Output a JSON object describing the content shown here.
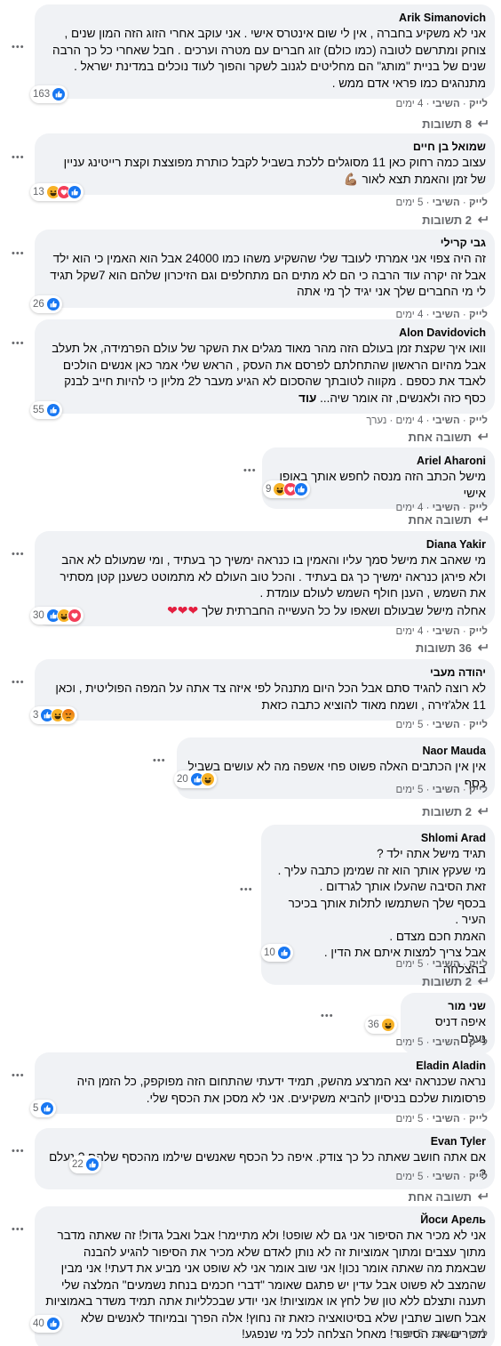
{
  "colors": {
    "bubble": "#f0f2f5",
    "meta": "#65676b",
    "like": "#1877f2",
    "love": "#f33e58",
    "haha": "#f7b125"
  },
  "icons": {
    "like": "like-reaction-icon",
    "love": "love-reaction-icon",
    "haha": "haha-reaction-icon",
    "angry": "angry-reaction-icon",
    "more": "more-options-icon",
    "reply": "reply-arrow-icon"
  },
  "comments": [
    {
      "author": "Arik Simanovich",
      "text": "אני לא משקיע בחברה , אין לי שום אינטרס אישי . אני עוקב אחרי הזוג הזה המון שנים , צוחק ומתרשם לטובה (כמו כולם) זוג חברים עם מטרה וערכים . חבל שאחרי כל כך הרבה שנים של בניית \"מותג\" הם מחליטים לגנוב לשקר והפוך לעוד נוכלים במדינת ישראל . מתנהגים כמו פראי אדם ממש .",
      "reactions": {
        "count": "163",
        "types": [
          "like"
        ]
      },
      "actions": {
        "like": "לייק",
        "reply": "השיבי",
        "time": "4 ימים"
      },
      "replies": "8 תשובות"
    },
    {
      "author": "שמואל בן חיים",
      "text": "עצוב כמה רחוק כאן 11 מסוגלים ללכת בשביל לקבל כותרת מפוצצת וקצת רייטינג עניין של זמן והאמת תצא לאור 💪🏽",
      "reactions": {
        "count": "13",
        "types": [
          "haha",
          "love",
          "like"
        ]
      },
      "actions": {
        "like": "לייק",
        "reply": "השיבי",
        "time": "5 ימים"
      },
      "replies": "2 תשובות"
    },
    {
      "author": "גבי קרילי",
      "text": "זה היה צפוי אני אמרתי לעובד שלי שהשקיע משהו כמו 24000 אבל הוא האמין כי הוא ילד אבל זה יקרה עוד הרבה כי הם לא מתים הם מתחלפים וגם הזיכרון שלהם הוא 7שקל תגיד לי מי החברים שלך אני יגיד לך מי אתה",
      "reactions": {
        "count": "26",
        "types": [
          "like"
        ]
      },
      "actions": {
        "like": "לייק",
        "reply": "השיבי",
        "time": "4 ימים"
      }
    },
    {
      "author": "Alon Davidovich",
      "text": "וואו איך שקצת זמן בעולם הזה מהר מאוד מגלים את השקר של עולם הפרמידה, אל תעלב אבל מהיום הראשון שהתחלתם לפרסם את העסק , הראש שלי אמר כאן אנשים הולכים לאבד את כספם . מקווה לטובתך שהסכום לא הגיע מעבר ל2 מליון כי להיות חייב לבנק כסף כזה ולאנשים, זה אומר שיה...",
      "more": "עוד",
      "reactions": {
        "count": "55",
        "types": [
          "like"
        ]
      },
      "actions": {
        "like": "לייק",
        "reply": "השיבי",
        "time": "4 ימים",
        "edited": "נערך"
      },
      "replies": "תשובה אחת"
    },
    {
      "author": "Ariel Aharoni",
      "text": "מישל הכתב הזה מנסה לחפש אותך באופן אישי",
      "reactions": {
        "count": "9",
        "types": [
          "haha",
          "love",
          "like"
        ]
      },
      "actions": {
        "like": "לייק",
        "reply": "השיבי",
        "time": "4 ימים"
      },
      "replies": "תשובה אחת"
    },
    {
      "author": "Diana Yakir",
      "text": "מי שאהב את מישל סמך עליו והאמין בו כנראה ימשיך כך בעתיד , ומי שמעולם לא אהב ולא פירגן כנראה ימשיך כך גם בעתיד . והכל טוב העולם לא מתמוטט כשענן קטן מסתיר את השמש , הענן חולף השמש לעולם עומדת .\nאחלה מישל שבעולם ושאפו על כל העשייה החברתית שלך",
      "hearts": "❤❤❤",
      "reactions": {
        "count": "30",
        "types": [
          "like",
          "haha",
          "love"
        ]
      },
      "actions": {
        "like": "לייק",
        "reply": "השיבי",
        "time": "4 ימים"
      },
      "replies": "36 תשובות"
    },
    {
      "author": "יהודה מעבי",
      "text": "לא רוצה להגיד סתם אבל הכל היום מתנהל לפי איזה צד אתה על המפה הפוליטית , וכאן 11 אלג'זירה , ושמח מאוד להוציא כתבה כזאת",
      "reactions": {
        "count": "3",
        "types": [
          "like",
          "haha",
          "angry"
        ]
      },
      "actions": {
        "like": "לייק",
        "reply": "השיבי",
        "time": "5 ימים"
      }
    },
    {
      "author": "Naor Mauda",
      "text": "אין אין הכתבים האלה פשוט פחי אשפה מה לא עושים בשביל כסף",
      "reactions": {
        "count": "20",
        "types": [
          "like",
          "haha"
        ]
      },
      "actions": {
        "like": "לייק",
        "reply": "השיבי",
        "time": "5 ימים"
      },
      "replies": "2 תשובות"
    },
    {
      "author": "Shlomi Arad",
      "text": "תגיד מישל אתה ילד ?\nמי שעקץ אותך הוא זה שמימן כתבה עליך .\nזאת הסיבה שהעלו אותך לגרדום .\nבכסף שלך השתמשו לתלות אותך בכיכר העיר .\nהאמת חכם מצדם .\nאבל צריך למצות איתם את הדין .\nבהצלחה",
      "reactions": {
        "count": "10",
        "types": [
          "like"
        ]
      },
      "actions": {
        "like": "לייק",
        "reply": "השיבי",
        "time": "5 ימים"
      },
      "replies": "2 תשובות"
    },
    {
      "author": "שני מור",
      "text": "איפה דניס נעלם",
      "reactions": {
        "count": "36",
        "types": [
          "haha"
        ]
      },
      "actions": {
        "like": "לייק",
        "reply": "השיבי",
        "time": "5 ימים"
      }
    },
    {
      "author": "Eladin Aladin",
      "text": "נראה שכנראה יצא המרצע מהשק, תמיד ידעתי שהתחום הזה מפוקפק, כל הזמן היה פרסומות שלכם בניסיון להביא משקיעים. אני לא מסכן את הכסף שלי.",
      "reactions": {
        "count": "5",
        "types": [
          "like"
        ]
      },
      "actions": {
        "like": "לייק",
        "reply": "השיבי",
        "time": "5 ימים"
      }
    },
    {
      "author": "Evan Tyler",
      "text": "אם אתה חושב שאתה כל כך צודק. איפה כל הכסף שאנשים שילמו מהכסף שלהם ? נעלם ?",
      "reactions": {
        "count": "22",
        "types": [
          "like"
        ]
      },
      "actions": {
        "like": "לייק",
        "reply": "השיבי",
        "time": "5 ימים"
      },
      "replies": "תשובה אחת"
    },
    {
      "author": "Йоси Арель",
      "text": "אני לא מכיר את הסיפור אני גם לא שופט! ולא מתיימר! אבל ואבל גדול! זה שאתה מדבר מתוך עצבים ומתוך אמוציות זה לא נותן לאדם שלא מכיר את הסיפור להגיע להבנה שבאמת מה שאתה אומר נכון! אני שוב אומר אני לא שופט אני מביע את דעתי! אני מבין שהמצב לא פשוט אבל עדין יש פתגם שאומר \"דברי חכמים בנחת נשמעים\" המלצה שלי תענה ותצלם ללא טון של לחץ או אמוציות! אני יודע שבכלליות אתה תמיד משדר באמוציות אבל חשוב שתבין שלא בסיטואציה כזאת זה נחוץ! אלה הפרך ובמיוחד לאנשים שלא מכירים את הסיפור! מאחל הצלחה לכל מי שנפגע!",
      "reactions": {
        "count": "40",
        "types": [
          "like"
        ]
      },
      "actions": {
        "like": "לייק",
        "reply": "השיבי",
        "time": "5 ימים"
      }
    }
  ]
}
